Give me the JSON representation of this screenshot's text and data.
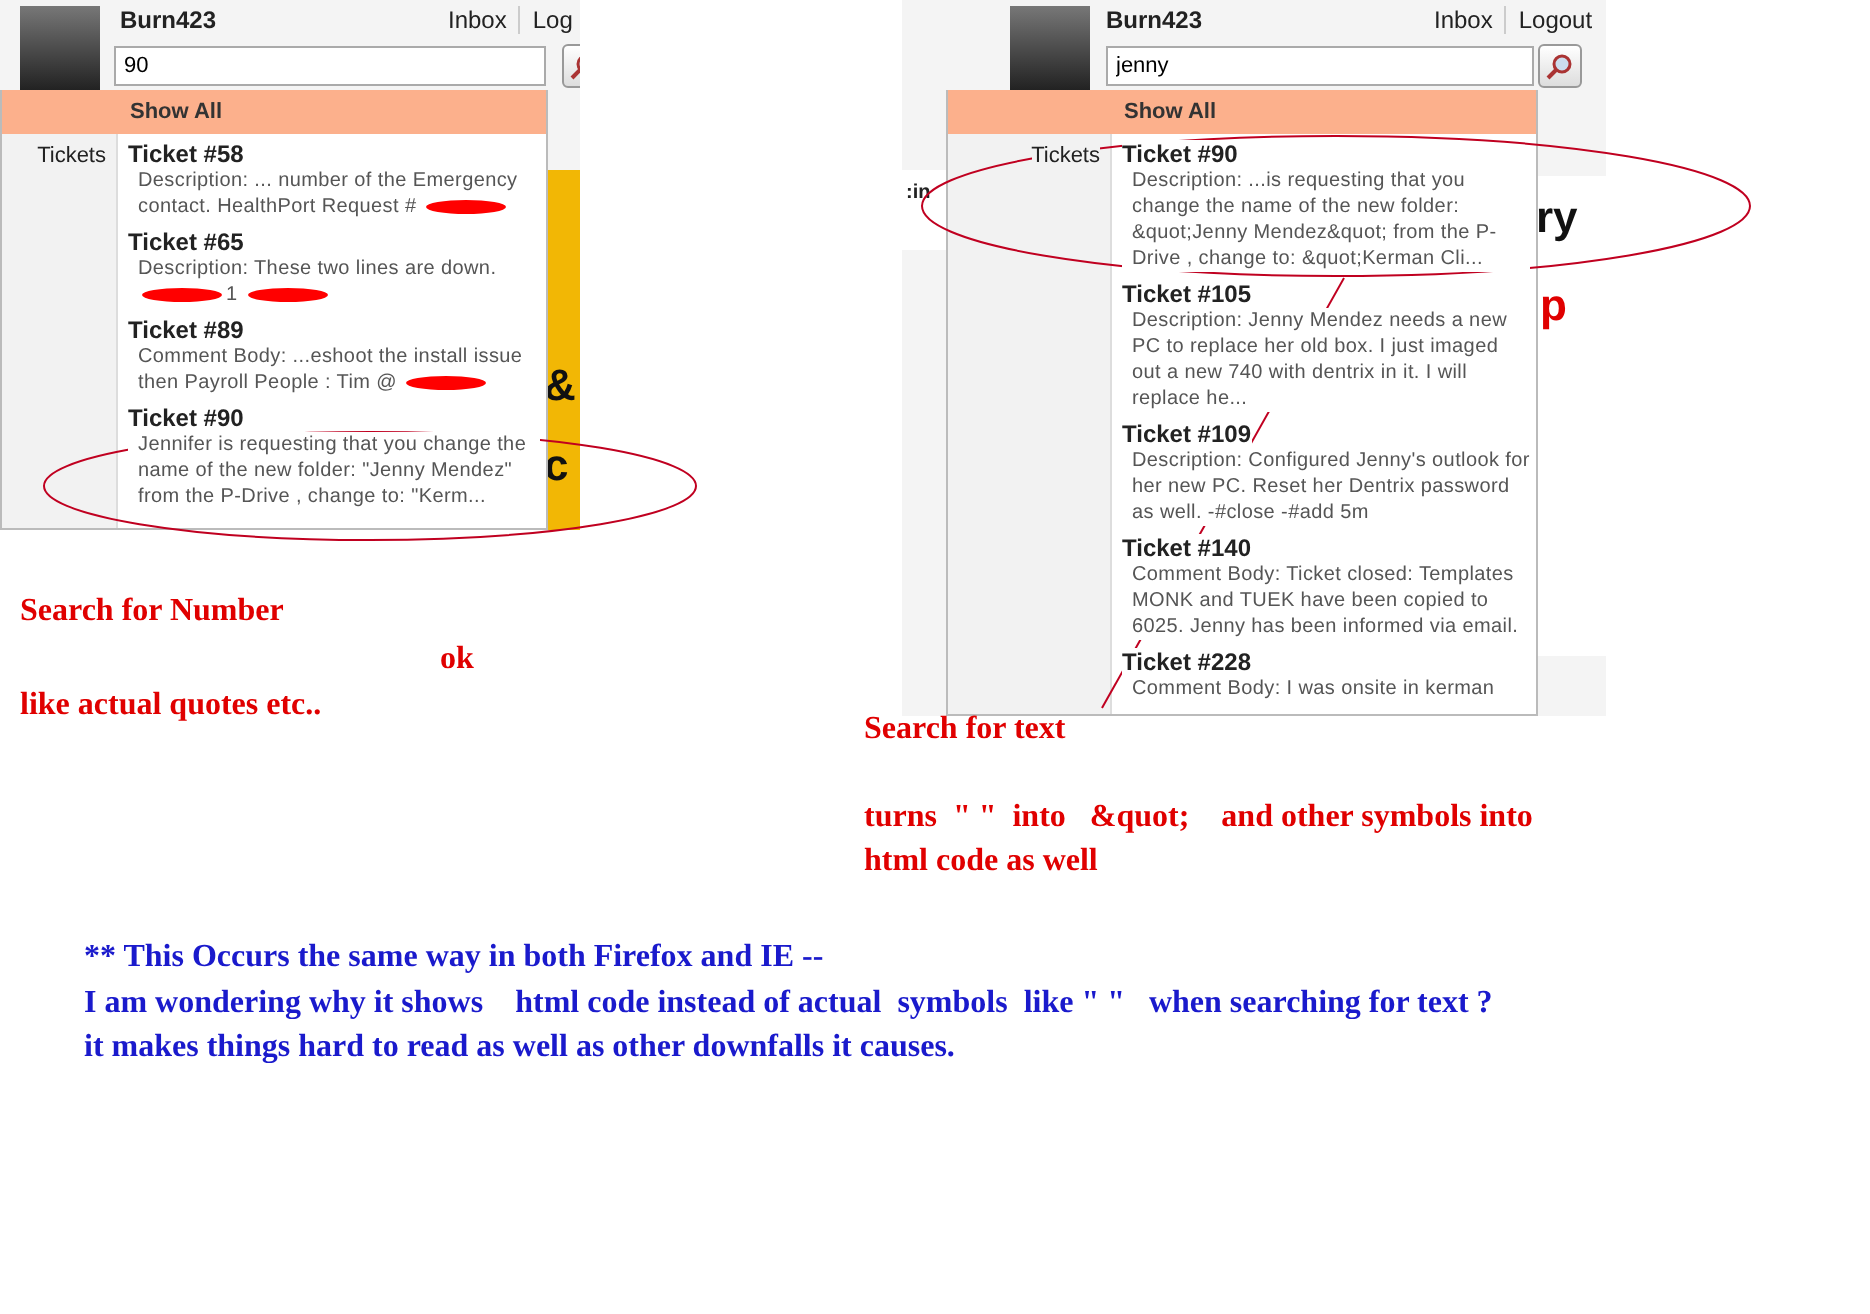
{
  "screenshots": [
    {
      "user": "Burn423",
      "links": [
        "Inbox",
        "Log"
      ],
      "search_value": "90",
      "show_all": "Show All",
      "section_label": "Tickets",
      "backdrop": [
        {
          "text": "&"
        },
        {
          "text": "c"
        }
      ],
      "results": [
        {
          "title": "Ticket #58",
          "parts": [
            {
              "kind": "text",
              "text": "Description: ... number of the Emergency contact. HealthPort Request #"
            },
            {
              "kind": "redaction"
            }
          ]
        },
        {
          "title": "Ticket #65",
          "parts": [
            {
              "kind": "text",
              "text": "Description: These two lines are down."
            },
            {
              "kind": "redaction"
            },
            {
              "kind": "text",
              "text": "1"
            },
            {
              "kind": "redaction"
            }
          ]
        },
        {
          "title": "Ticket #89",
          "parts": [
            {
              "kind": "text",
              "text": "Comment Body: ...eshoot the install issue then Payroll People : Tim @"
            },
            {
              "kind": "redaction"
            }
          ]
        },
        {
          "title": "Ticket #90",
          "parts": [
            {
              "kind": "text",
              "text": "Jennifer is requesting that you change the name of the new folder: \"Jenny Mendez\" from the P-Drive , change to: \"Kerm..."
            }
          ]
        }
      ]
    },
    {
      "user": "Burn423",
      "links": [
        "Inbox",
        "Logout"
      ],
      "search_value": "jenny",
      "show_all": "Show All",
      "section_label": "Tickets",
      "backdrop": [
        {
          "text": ":in"
        },
        {
          "text": "ry"
        },
        {
          "text": "p"
        }
      ],
      "results": [
        {
          "title": "Ticket #90",
          "parts": [
            {
              "kind": "text",
              "text": "Description: ...is requesting that you change the name of the new folder: &quot;Jenny Mendez&quot; from the P-Drive , change to: &quot;Kerman Cli..."
            }
          ]
        },
        {
          "title": "Ticket #105",
          "parts": [
            {
              "kind": "text",
              "text": "Description: Jenny Mendez needs a new PC to replace her old box. I just imaged out a new 740 with dentrix in it. I will replace he..."
            }
          ]
        },
        {
          "title": "Ticket #109",
          "parts": [
            {
              "kind": "text",
              "text": "Description: Configured Jenny's outlook for her new PC. Reset her Dentrix password as well. -#close -#add 5m"
            }
          ]
        },
        {
          "title": "Ticket #140",
          "parts": [
            {
              "kind": "text",
              "text": "Comment Body: Ticket closed: Templates MONK and TUEK have been copied to 6025. Jenny has been informed via email."
            }
          ]
        },
        {
          "title": "Ticket #228",
          "parts": [
            {
              "kind": "text",
              "text": "Comment Body: I was onsite in kerman"
            }
          ]
        }
      ]
    }
  ],
  "annotations": [
    {
      "text": "Search for Number",
      "color": "#e00000"
    },
    {
      "text": "ok",
      "color": "#e00000"
    },
    {
      "text": "like actual quotes etc..",
      "color": "#e00000"
    },
    {
      "text": "Search for text",
      "color": "#e00000"
    },
    {
      "text": "turns  \" \"  into   &quot;    and other symbols into",
      "color": "#e00000"
    },
    {
      "text": "html code as well",
      "color": "#e00000"
    },
    {
      "text": "** This Occurs the same way in both Firefox and IE --",
      "color": "#1a1acc"
    },
    {
      "text": "I am wondering why it shows    html code instead of actual  symbols  like \" \"   when searching for text ?",
      "color": "#1a1acc"
    },
    {
      "text": "it makes things hard to read as well as other downfalls it causes.",
      "color": "#1a1acc"
    }
  ]
}
